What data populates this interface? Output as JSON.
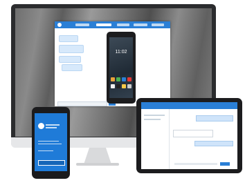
{
  "monitor_screen": {
    "app_window": {
      "title_bar": {
        "accent_color": "#2a7fd6"
      },
      "tabs": [
        "",
        "",
        "",
        "",
        ""
      ],
      "chat_messages": [
        {
          "side": "left"
        },
        {
          "side": "left"
        },
        {
          "side": "left"
        },
        {
          "side": "left"
        }
      ],
      "send_button": {
        "color": "#2a7fd6"
      }
    },
    "mirrored_phone": {
      "clock_time": "11:02"
    }
  },
  "phone_device": {
    "screen_color": "#1f7bd8"
  },
  "tablet_device": {
    "header_color": "#2a7fd6"
  }
}
